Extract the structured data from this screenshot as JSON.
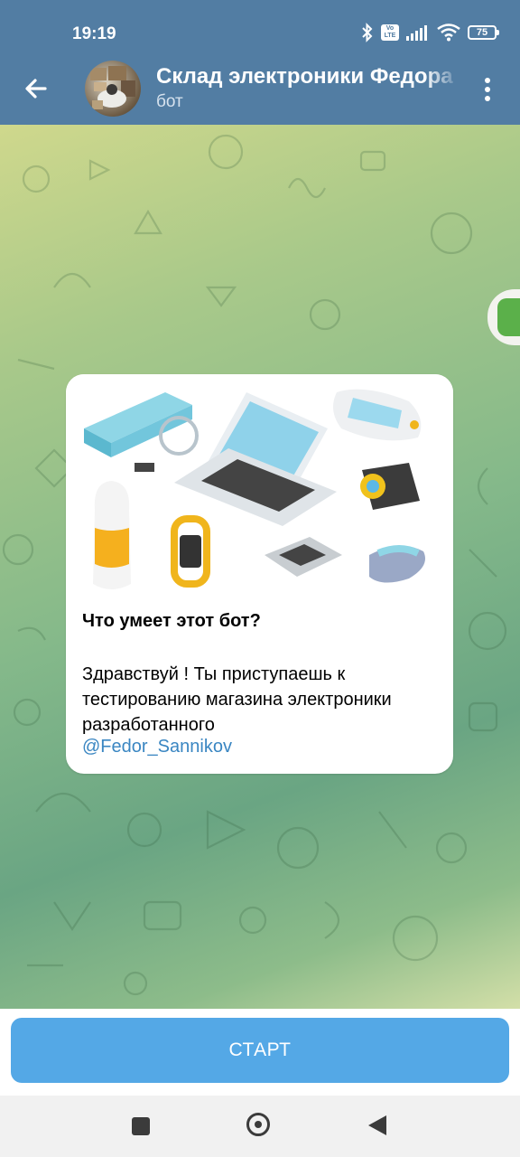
{
  "status_bar": {
    "time": "19:19",
    "volte_label": "Vo LTE",
    "battery_level": "75",
    "icons": [
      "bluetooth-icon",
      "volte-icon",
      "signal-icon",
      "wifi-icon",
      "battery-icon"
    ]
  },
  "header": {
    "title": "Склад электроники Федора",
    "subtitle": "бот",
    "back_icon": "arrow-left-icon",
    "menu_icon": "more-vertical-icon",
    "background_color": "#527da3"
  },
  "message": {
    "title": "Что умеет этот бот?",
    "text": "Здравствуй ! Ты приступаешь к тестированию магазина электроники разработанного",
    "link": "@Fedor_Sannikov",
    "link_color": "#3a86c2"
  },
  "bottom": {
    "start_label": "СТАРТ",
    "button_color": "#54a8e6"
  },
  "nav": {
    "icons": [
      "recents-icon",
      "home-icon",
      "back-triangle-icon"
    ]
  }
}
